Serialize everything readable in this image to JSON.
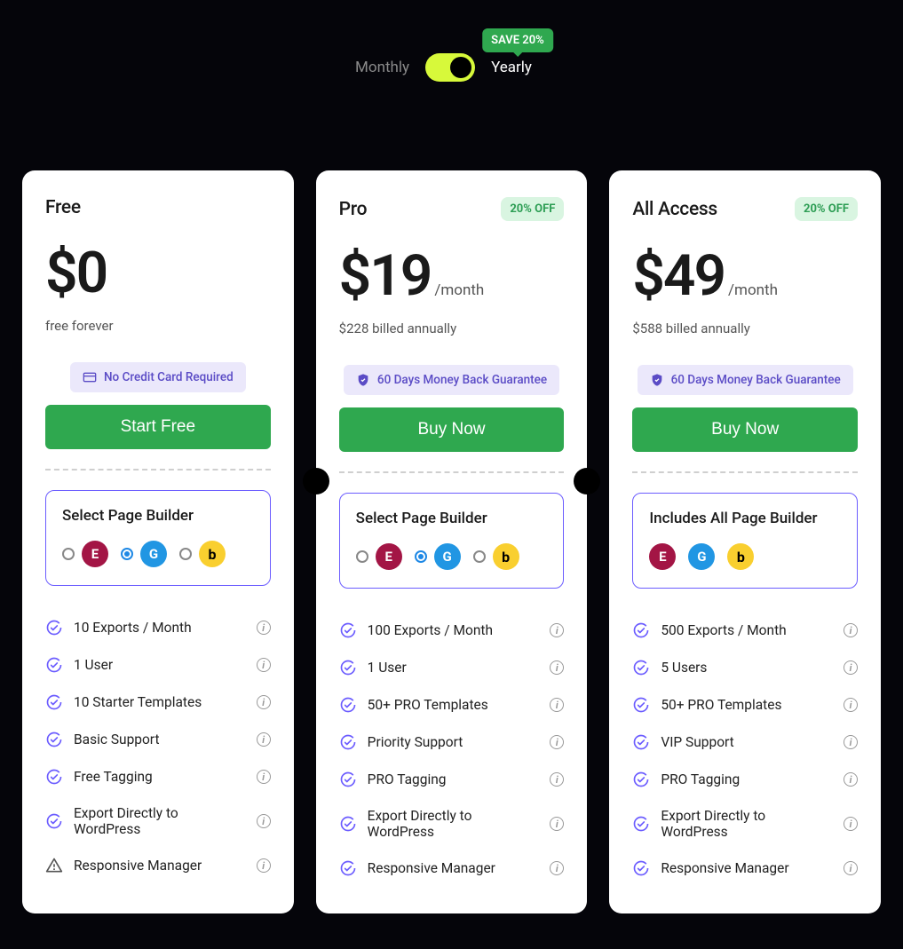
{
  "period": {
    "monthly_label": "Monthly",
    "yearly_label": "Yearly",
    "save_badge": "SAVE 20%"
  },
  "builder_label_select": "Select Page Builder",
  "builder_label_all": "Includes All Page Builder",
  "plans": [
    {
      "name": "Free",
      "price": "$0",
      "per": "",
      "sub": "free forever",
      "discount": "",
      "note": "No Credit Card Required",
      "cta": "Start Free",
      "builder_mode": "select",
      "features": [
        {
          "text": "10 Exports / Month",
          "ok": true
        },
        {
          "text": "1 User",
          "ok": true
        },
        {
          "text": "10 Starter Templates",
          "ok": true
        },
        {
          "text": "Basic Support",
          "ok": true
        },
        {
          "text": "Free Tagging",
          "ok": true
        },
        {
          "text": "Export Directly to WordPress",
          "ok": true
        },
        {
          "text": "Responsive Manager",
          "ok": false
        }
      ]
    },
    {
      "name": "Pro",
      "price": "$19",
      "per": "/month",
      "sub": "$228 billed annually",
      "discount": "20% OFF",
      "note": "60 Days Money Back Guarantee",
      "cta": "Buy Now",
      "builder_mode": "select",
      "features": [
        {
          "text": "100 Exports / Month",
          "ok": true
        },
        {
          "text": "1 User",
          "ok": true
        },
        {
          "text": "50+ PRO Templates",
          "ok": true
        },
        {
          "text": "Priority Support",
          "ok": true
        },
        {
          "text": "PRO Tagging",
          "ok": true
        },
        {
          "text": "Export Directly to WordPress",
          "ok": true
        },
        {
          "text": "Responsive Manager",
          "ok": true
        }
      ]
    },
    {
      "name": "All Access",
      "price": "$49",
      "per": "/month",
      "sub": "$588 billed annually",
      "discount": "20% OFF",
      "note": "60 Days Money Back Guarantee",
      "cta": "Buy Now",
      "builder_mode": "all",
      "features": [
        {
          "text": "500 Exports / Month",
          "ok": true
        },
        {
          "text": "5 Users",
          "ok": true
        },
        {
          "text": "50+ PRO Templates",
          "ok": true
        },
        {
          "text": "VIP Support",
          "ok": true
        },
        {
          "text": "PRO Tagging",
          "ok": true
        },
        {
          "text": "Export Directly to WordPress",
          "ok": true
        },
        {
          "text": "Responsive Manager",
          "ok": true
        }
      ]
    }
  ]
}
